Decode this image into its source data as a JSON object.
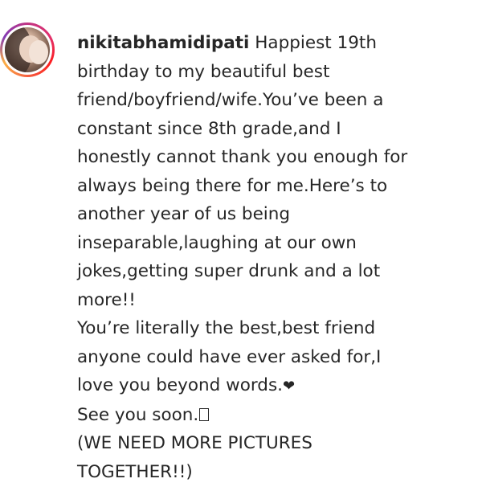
{
  "post": {
    "username": "nikitabhamidipati",
    "caption_lines": [
      "Happiest 19th",
      "birthday to my beautiful best",
      "friend/boyfriend/wife.You’ve been a",
      "constant since 8th grade,and I",
      "honestly cannot thank you enough for",
      "always being there for me.Here’s to",
      "another year of us being",
      "inseparable,laughing at our own",
      "jokes,getting super drunk and a lot",
      "more!!",
      "You’re literally the best,best friend",
      "anyone could have ever asked for,I",
      "love you beyond words.",
      "See you soon.",
      "(WE NEED MORE PICTURES",
      "TOGETHER!!)"
    ],
    "heart_emoji": "❤"
  }
}
